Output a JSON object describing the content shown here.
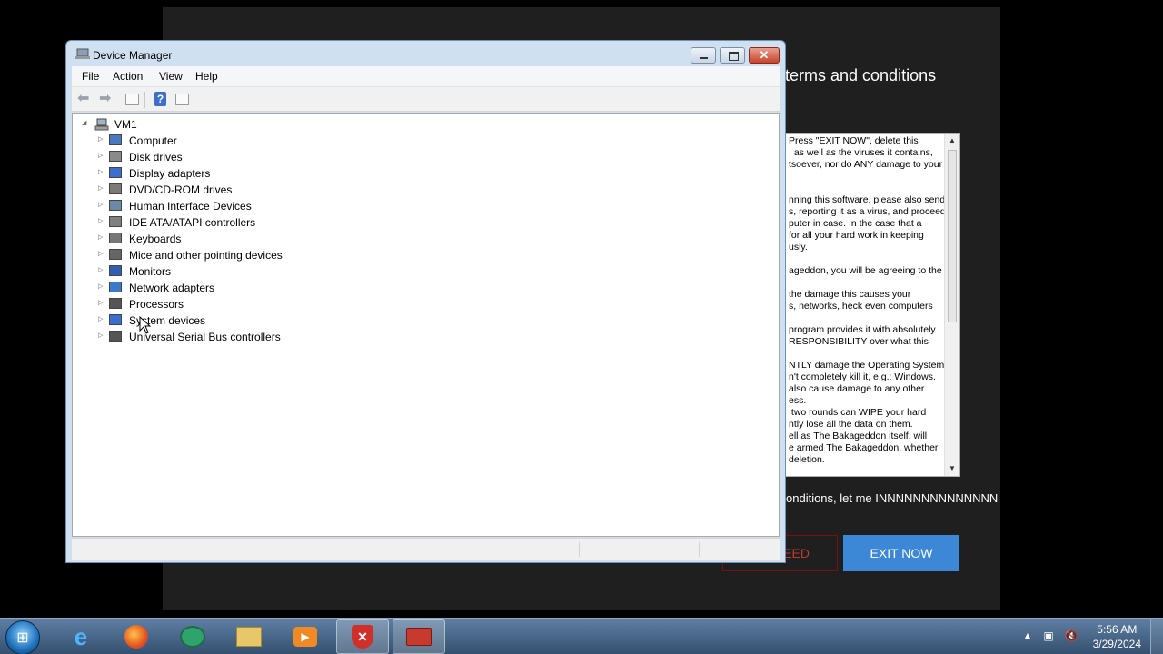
{
  "background_app": {
    "title": "terms and conditions",
    "terms_text": "Press \"EXIT NOW\", delete this\n, as well as the viruses it contains,\ntsoever, nor do ANY damage to your\n\n\nnning this software, please also send\ns, reporting it as a virus, and proceed\nputer in case. In the case that a\nfor all your hard work in keeping\nusly.\n\nageddon, you will be agreeing to the\n\nthe damage this causes your\ns, networks, heck even computers\n\nprogram provides it with absolutely\nRESPONSIBILITY over what this\n\nNTLY damage the Operating System\nn't completely kill it, e.g.: Windows.\nalso cause damage to any other\ness.\n two rounds can WIPE your hard\nntly lose all the data on them.\nell as The Bakageddon itself, will\ne armed The Bakageddon, whether\ndeletion.",
    "agree_text": "onditions, let me INNNNNNNNNNNNNN",
    "proceed_label": "EED",
    "exit_label": "EXIT NOW",
    "colors": {
      "exit_button": "#3c88d6",
      "proceed_border": "#7a1010",
      "proceed_text": "#c0392b"
    }
  },
  "device_manager": {
    "title": "Device Manager",
    "menu": [
      "File",
      "Action",
      "View",
      "Help"
    ],
    "toolbar": {
      "icons": [
        "back-arrow-icon",
        "forward-arrow-icon",
        "show-hide-console-tree-icon",
        "help-icon",
        "properties-icon"
      ],
      "help_glyph": "?"
    },
    "tree": {
      "root": "VM1",
      "items": [
        {
          "label": "Computer",
          "icon": "computer-icon"
        },
        {
          "label": "Disk drives",
          "icon": "disk-drive-icon"
        },
        {
          "label": "Display adapters",
          "icon": "display-adapter-icon"
        },
        {
          "label": "DVD/CD-ROM drives",
          "icon": "dvd-drive-icon"
        },
        {
          "label": "Human Interface Devices",
          "icon": "hid-icon"
        },
        {
          "label": "IDE ATA/ATAPI controllers",
          "icon": "ide-controller-icon"
        },
        {
          "label": "Keyboards",
          "icon": "keyboard-icon"
        },
        {
          "label": "Mice and other pointing devices",
          "icon": "mouse-icon"
        },
        {
          "label": "Monitors",
          "icon": "monitor-icon"
        },
        {
          "label": "Network adapters",
          "icon": "network-adapter-icon"
        },
        {
          "label": "Processors",
          "icon": "processor-icon"
        },
        {
          "label": "System devices",
          "icon": "system-devices-icon"
        },
        {
          "label": "Universal Serial Bus controllers",
          "icon": "usb-icon"
        }
      ]
    }
  },
  "taskbar": {
    "apps": [
      "internet-explorer-icon",
      "firefox-icon",
      "messenger-icon",
      "file-explorer-icon",
      "media-player-icon",
      "security-alert-icon",
      "toolbox-icon"
    ],
    "tray": {
      "time": "5:56 AM",
      "date": "3/29/2024"
    }
  }
}
